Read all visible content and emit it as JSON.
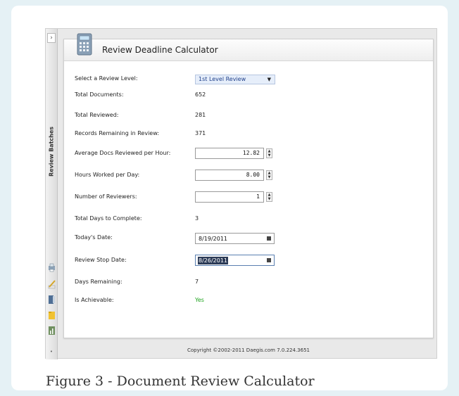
{
  "sidebar": {
    "toggle_icon": "chevron-right-icon",
    "label": "Review Batches",
    "icons": [
      "printer-icon",
      "pencil-icon",
      "binder-icon",
      "folder-icon",
      "chart-icon"
    ],
    "bottom_icon": "dot-icon"
  },
  "panel": {
    "title": "Review Deadline Calculator",
    "icon": "calculator-icon"
  },
  "form": {
    "review_level": {
      "label": "Select a Review Level:",
      "value": "1st Level Review"
    },
    "total_documents": {
      "label": "Total Documents:",
      "value": "652"
    },
    "total_reviewed": {
      "label": "Total Reviewed:",
      "value": "281"
    },
    "records_remaining": {
      "label": "Records Remaining in Review:",
      "value": "371"
    },
    "avg_docs_per_hour": {
      "label": "Average Docs Reviewed per Hour:",
      "value": "12.82"
    },
    "hours_per_day": {
      "label": "Hours Worked per Day:",
      "value": "8.00"
    },
    "num_reviewers": {
      "label": "Number of Reviewers:",
      "value": "1"
    },
    "total_days": {
      "label": "Total Days to Complete:",
      "value": "3"
    },
    "todays_date": {
      "label": "Today's Date:",
      "value": "8/19/2011"
    },
    "stop_date": {
      "label": "Review Stop Date:",
      "value": "8/26/2011"
    },
    "days_remaining": {
      "label": "Days Remaining:",
      "value": "7"
    },
    "is_achievable": {
      "label": "Is Achievable:",
      "value": "Yes"
    }
  },
  "footer": {
    "text": "Copyright ©2002-2011 Daegis.com 7.0.224.3651"
  },
  "caption": {
    "text": "Figure 3 - Document Review Calculator"
  },
  "colors": {
    "achievable": "#21a421",
    "page_background": "#e5f1f5"
  }
}
